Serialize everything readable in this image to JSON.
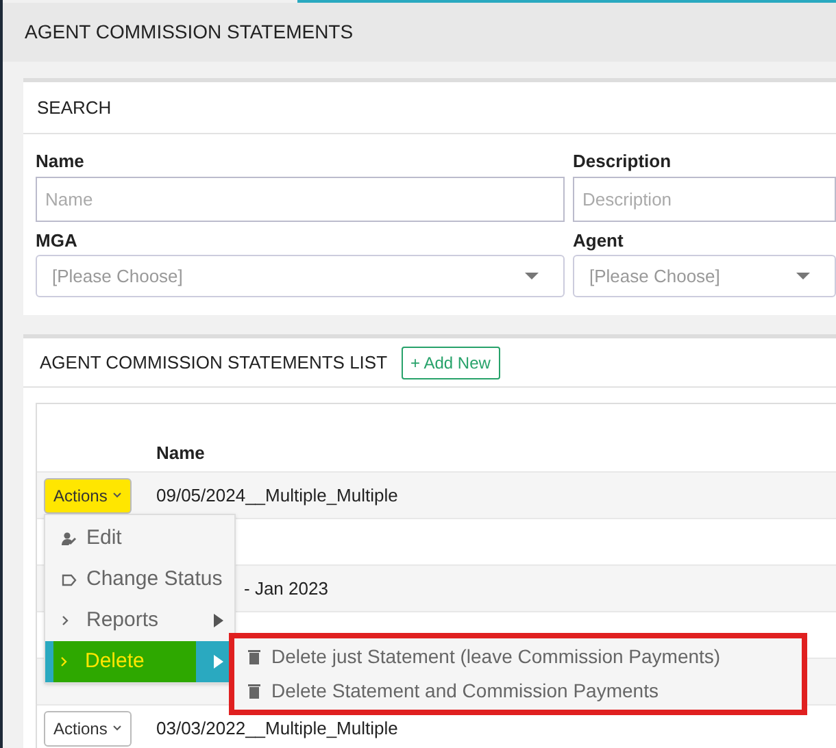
{
  "page_title": "AGENT COMMISSION STATEMENTS",
  "search": {
    "title": "SEARCH",
    "fields": [
      {
        "label": "Name",
        "kind": "text",
        "placeholder": "Name"
      },
      {
        "label": "Description",
        "kind": "text",
        "placeholder": "Description"
      },
      {
        "label": "MGA",
        "kind": "select",
        "placeholder": "[Please Choose]"
      },
      {
        "label": "Agent",
        "kind": "select",
        "placeholder": "[Please Choose]"
      }
    ]
  },
  "list": {
    "title": "AGENT COMMISSION STATEMENTS LIST",
    "add_button": "+ Add New",
    "columns": [
      "Name"
    ],
    "rows": [
      {
        "actions": "Actions",
        "highlighted": true,
        "name": "09/05/2024__Multiple_Multiple"
      },
      {},
      {
        "name": "- Jan 2023"
      },
      {},
      {},
      {
        "actions": "Actions",
        "highlighted": false,
        "name": "03/03/2022__Multiple_Multiple"
      }
    ]
  },
  "actions_menu": {
    "items": [
      {
        "label": "Edit",
        "kind": "plain",
        "selected": false
      },
      {
        "label": "Change Status",
        "kind": "plain",
        "selected": false
      },
      {
        "label": "Reports",
        "kind": "submenu",
        "selected": false
      },
      {
        "label": "Delete",
        "kind": "submenu",
        "selected": true
      }
    ]
  },
  "submenu": {
    "highlighted": true,
    "items": [
      "Delete just Statement (leave Commission Payments)",
      "Delete Statement and Commission Payments"
    ]
  }
}
